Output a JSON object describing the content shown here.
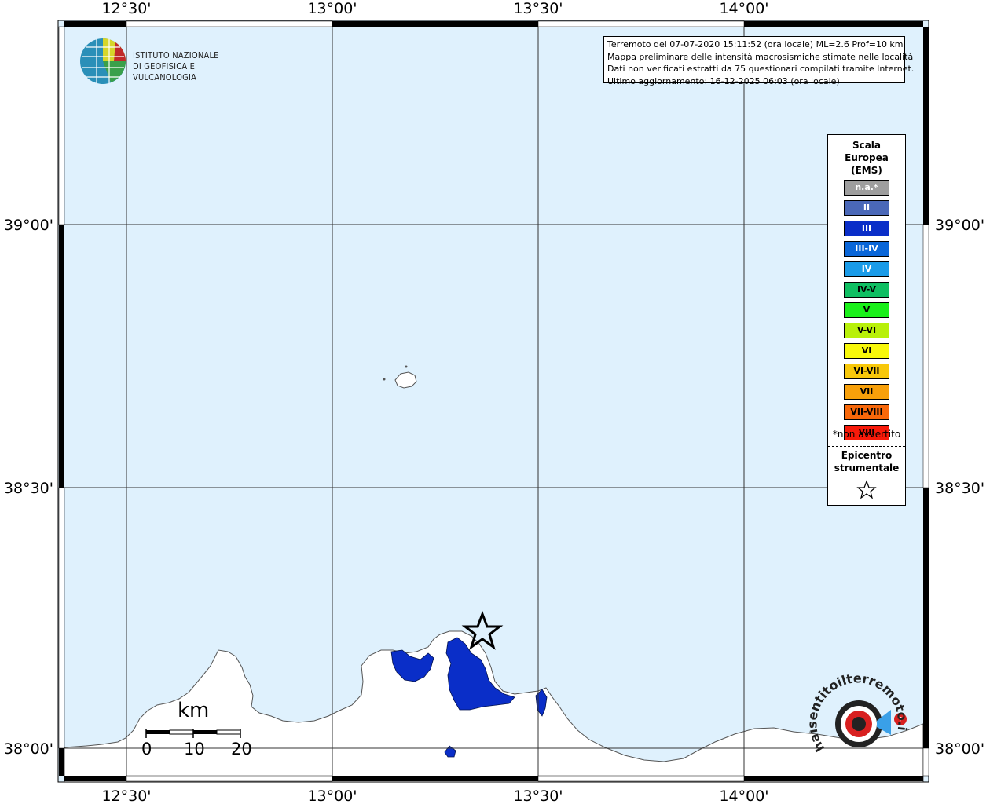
{
  "map": {
    "lon_labels": [
      "12°30'",
      "13°00'",
      "13°30'",
      "14°00'"
    ],
    "lat_labels": [
      "39°00'",
      "38°30'",
      "38°00'"
    ]
  },
  "logo": {
    "line1": "ISTITUTO NAZIONALE",
    "line2": "DI GEOFISICA E VULCANOLOGIA"
  },
  "info": {
    "line1": "Terremoto del 07-07-2020 15:11:52 (ora locale) ML=2.6 Prof=10 km",
    "line2": "Mappa preliminare delle intensità macrosismiche stimate nelle località",
    "line3": "Dati non verificati estratti da 75 questionari compilati tramite Internet.",
    "line4": "Ultimo aggiornamento: 16-12-2025 06:03 (ora locale)"
  },
  "legend": {
    "title1": "Scala",
    "title2": "Europea",
    "title3": "(EMS)",
    "items": [
      {
        "label": "n.a.*",
        "color": "#9e9e9e",
        "text_color": "#ffffff"
      },
      {
        "label": "II",
        "color": "#4a68b8",
        "text_color": "#ffffff"
      },
      {
        "label": "III",
        "color": "#0a2ec8",
        "text_color": "#ffffff"
      },
      {
        "label": "III-IV",
        "color": "#0a66d8",
        "text_color": "#ffffff"
      },
      {
        "label": "IV",
        "color": "#1a9be8",
        "text_color": "#ffffff"
      },
      {
        "label": "IV-V",
        "color": "#0fbf62",
        "text_color": "#000000"
      },
      {
        "label": "V",
        "color": "#1af01a",
        "text_color": "#000000"
      },
      {
        "label": "V-VI",
        "color": "#b8f00a",
        "text_color": "#000000"
      },
      {
        "label": "VI",
        "color": "#f8f80a",
        "text_color": "#000000"
      },
      {
        "label": "VI-VII",
        "color": "#f8c80a",
        "text_color": "#000000"
      },
      {
        "label": "VII",
        "color": "#f8a00a",
        "text_color": "#000000"
      },
      {
        "label": "VII-VIII",
        "color": "#f8680a",
        "text_color": "#000000"
      },
      {
        "label": "VIII",
        "color": "#f81a0a",
        "text_color": "#000000"
      }
    ],
    "note": "*non avvertito",
    "epi1": "Epicentro",
    "epi2": "strumentale"
  },
  "scale": {
    "unit": "km",
    "ticks": [
      "0",
      "10",
      "20"
    ]
  },
  "badge": {
    "text": "haisentitoilterremoto.it"
  },
  "colors": {
    "sea": "#dff1fd",
    "land": "#ffffff",
    "intensity_iii": "#0a2ec8"
  }
}
